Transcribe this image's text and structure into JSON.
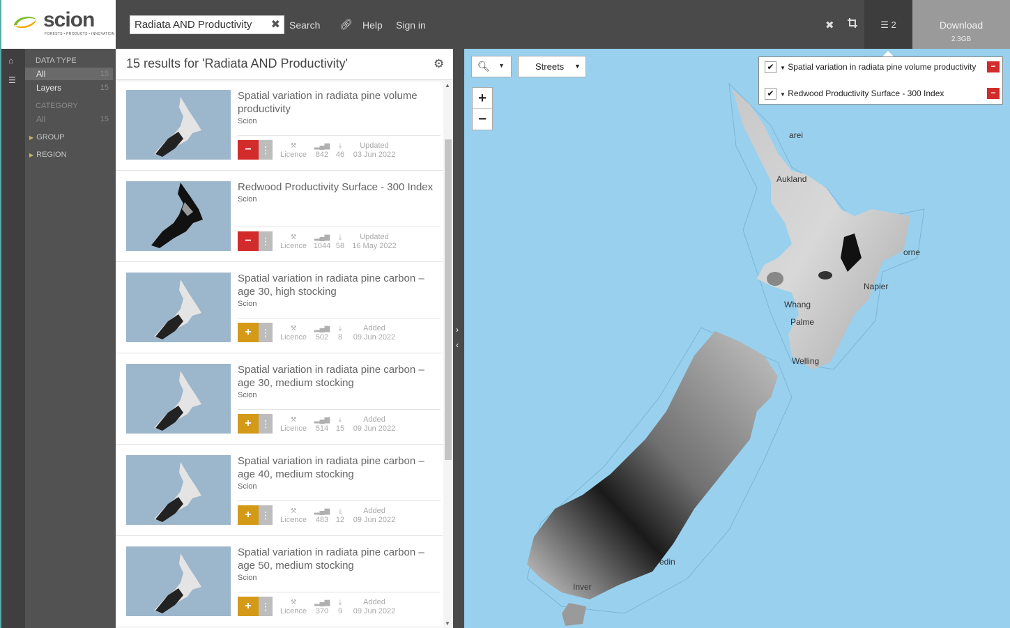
{
  "brand": {
    "name": "scion",
    "tagline": "FORESTS • PRODUCTS • INNOVATION"
  },
  "search": {
    "value": "Radiata AND Productivity",
    "button": "Search"
  },
  "topnav": {
    "help": "Help",
    "signin": "Sign in"
  },
  "layers_count": "2",
  "download": {
    "label": "Download",
    "size": "2.3GB"
  },
  "filters": {
    "data_type_heading": "DATA TYPE",
    "data_type_items": [
      {
        "label": "All",
        "count": "15"
      },
      {
        "label": "Layers",
        "count": "15"
      }
    ],
    "category_heading": "CATEGORY",
    "category_items": [
      {
        "label": "All",
        "count": "15"
      }
    ],
    "group": "GROUP",
    "region": "REGION"
  },
  "results": {
    "title": "15 results for 'Radiata AND Productivity'",
    "items": [
      {
        "title": "Spatial variation in radiata pine volume productivity",
        "org": "Scion",
        "action": "remove",
        "licence": "Licence",
        "views": "842",
        "downloads": "46",
        "date_label": "Updated",
        "date": "03 Jun 2022"
      },
      {
        "title": "Redwood Productivity Surface - 300 Index",
        "org": "Scion",
        "action": "remove",
        "licence": "Licence",
        "views": "1044",
        "downloads": "58",
        "date_label": "Updated",
        "date": "16 May 2022"
      },
      {
        "title": "Spatial variation in radiata pine carbon – age 30, high stocking",
        "org": "Scion",
        "action": "add",
        "licence": "Licence",
        "views": "502",
        "downloads": "8",
        "date_label": "Added",
        "date": "09 Jun 2022"
      },
      {
        "title": "Spatial variation in radiata pine carbon – age 30, medium stocking",
        "org": "Scion",
        "action": "add",
        "licence": "Licence",
        "views": "514",
        "downloads": "15",
        "date_label": "Added",
        "date": "09 Jun 2022"
      },
      {
        "title": "Spatial variation in radiata pine carbon – age 40, medium stocking",
        "org": "Scion",
        "action": "add",
        "licence": "Licence",
        "views": "483",
        "downloads": "12",
        "date_label": "Added",
        "date": "09 Jun 2022"
      },
      {
        "title": "Spatial variation in radiata pine carbon – age 50, medium stocking",
        "org": "Scion",
        "action": "add",
        "licence": "Licence",
        "views": "370",
        "downloads": "9",
        "date_label": "Added",
        "date": "09 Jun 2022"
      }
    ]
  },
  "map": {
    "basemap": "Streets",
    "labels": [
      "Aukland",
      "Whang",
      "Palme",
      "Welling",
      "Napier",
      "orne",
      "Gisborne",
      "Inver",
      "edin",
      "arei"
    ],
    "legend": [
      {
        "title": "Spatial variation in radiata pine volume productivity"
      },
      {
        "title": "Redwood Productivity Surface - 300 Index"
      }
    ]
  },
  "colors": {
    "accent_remove": "#d22b2b",
    "accent_add": "#d49a17",
    "water": "#99d0ee",
    "topbar": "#4a4a4a"
  }
}
